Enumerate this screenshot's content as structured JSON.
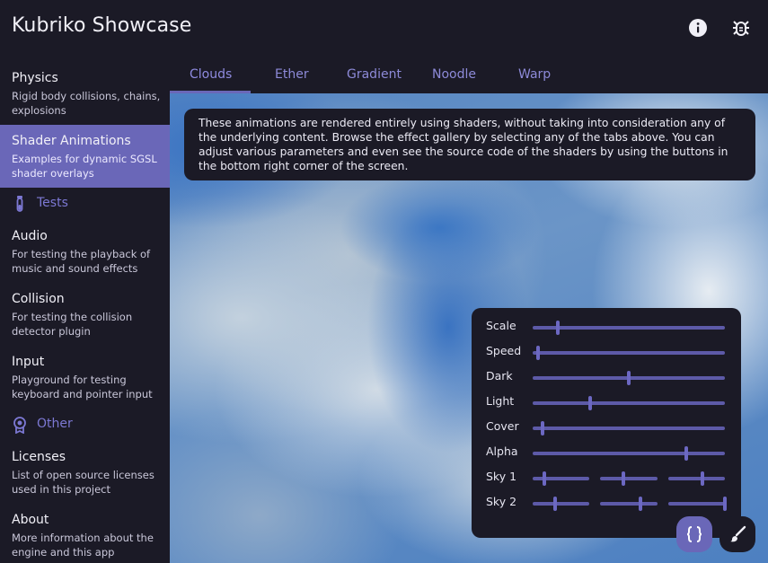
{
  "app": {
    "title": "Kubriko Showcase"
  },
  "header": {
    "info_icon": "info-icon",
    "bug_icon": "bug-icon"
  },
  "sidebar": {
    "items": [
      {
        "title": "Physics",
        "desc": "Rigid body collisions, chains, explosions"
      },
      {
        "title": "Shader Animations",
        "desc": "Examples for dynamic SGSL shader overlays"
      },
      {
        "title": "Audio",
        "desc": "For testing the playback of music and sound effects"
      },
      {
        "title": "Collision",
        "desc": "For testing the collision detector plugin"
      },
      {
        "title": "Input",
        "desc": "Playground for testing keyboard and pointer input"
      },
      {
        "title": "Licenses",
        "desc": "List of open source licenses used in this project"
      },
      {
        "title": "About",
        "desc": "More information about the engine and this app"
      }
    ],
    "sections": [
      {
        "label": "Tests",
        "icon": "test-tube-icon"
      },
      {
        "label": "Other",
        "icon": "badge-icon"
      }
    ]
  },
  "tabs": [
    "Clouds",
    "Ether",
    "Gradient",
    "Noodle",
    "Warp"
  ],
  "notice": "These animations are rendered entirely using shaders, without taking into consideration any of the underlying content. Browse the effect gallery by selecting any of the tabs above. You can adjust various parameters and even see the source code of the shaders by using the buttons in the bottom right corner of the screen.",
  "controls": [
    {
      "label": "Scale",
      "values": [
        0.13
      ]
    },
    {
      "label": "Speed",
      "values": [
        0.03
      ]
    },
    {
      "label": "Dark",
      "values": [
        0.5
      ]
    },
    {
      "label": "Light",
      "values": [
        0.3
      ]
    },
    {
      "label": "Cover",
      "values": [
        0.05
      ]
    },
    {
      "label": "Alpha",
      "values": [
        0.8
      ]
    },
    {
      "label": "Sky 1",
      "values": [
        0.2,
        0.4,
        0.6
      ]
    },
    {
      "label": "Sky 2",
      "values": [
        0.4,
        0.7,
        1.0
      ]
    }
  ],
  "colors": {
    "accent": "#6a67b8",
    "background": "#1b1a26",
    "slider": "#5d5aa8"
  }
}
